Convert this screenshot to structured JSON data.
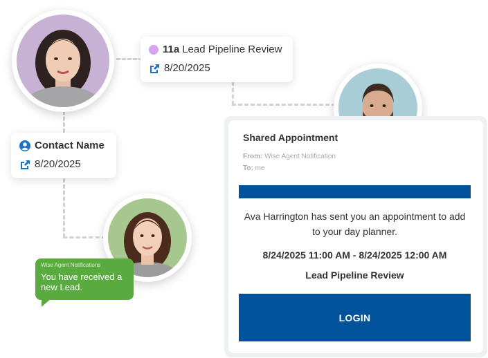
{
  "event_card": {
    "time": "11a",
    "title": "Lead Pipeline Review",
    "date": "8/20/2025",
    "dot_color": "#d6a4f0"
  },
  "contact_card": {
    "label": "Contact Name",
    "date": "8/20/2025"
  },
  "notification": {
    "sender": "Wise Agent Notifications",
    "message": "You have received a new Lead."
  },
  "email": {
    "title": "Shared Appointment",
    "from_label": "From:",
    "from_value": "Wise Agent Notification",
    "to_label": "To:",
    "to_value": "me",
    "body": "Ava Harrington has sent you an appointment to add to your day planner.",
    "time_range": "8/24/2025 11:00 AM - 8/24/2025 12:00 AM",
    "appointment_name": "Lead Pipeline Review",
    "login_label": "LOGIN",
    "brand_color": "#00539b"
  },
  "colors": {
    "accent_blue": "#1a73c9",
    "notification_green": "#5aab3f"
  }
}
